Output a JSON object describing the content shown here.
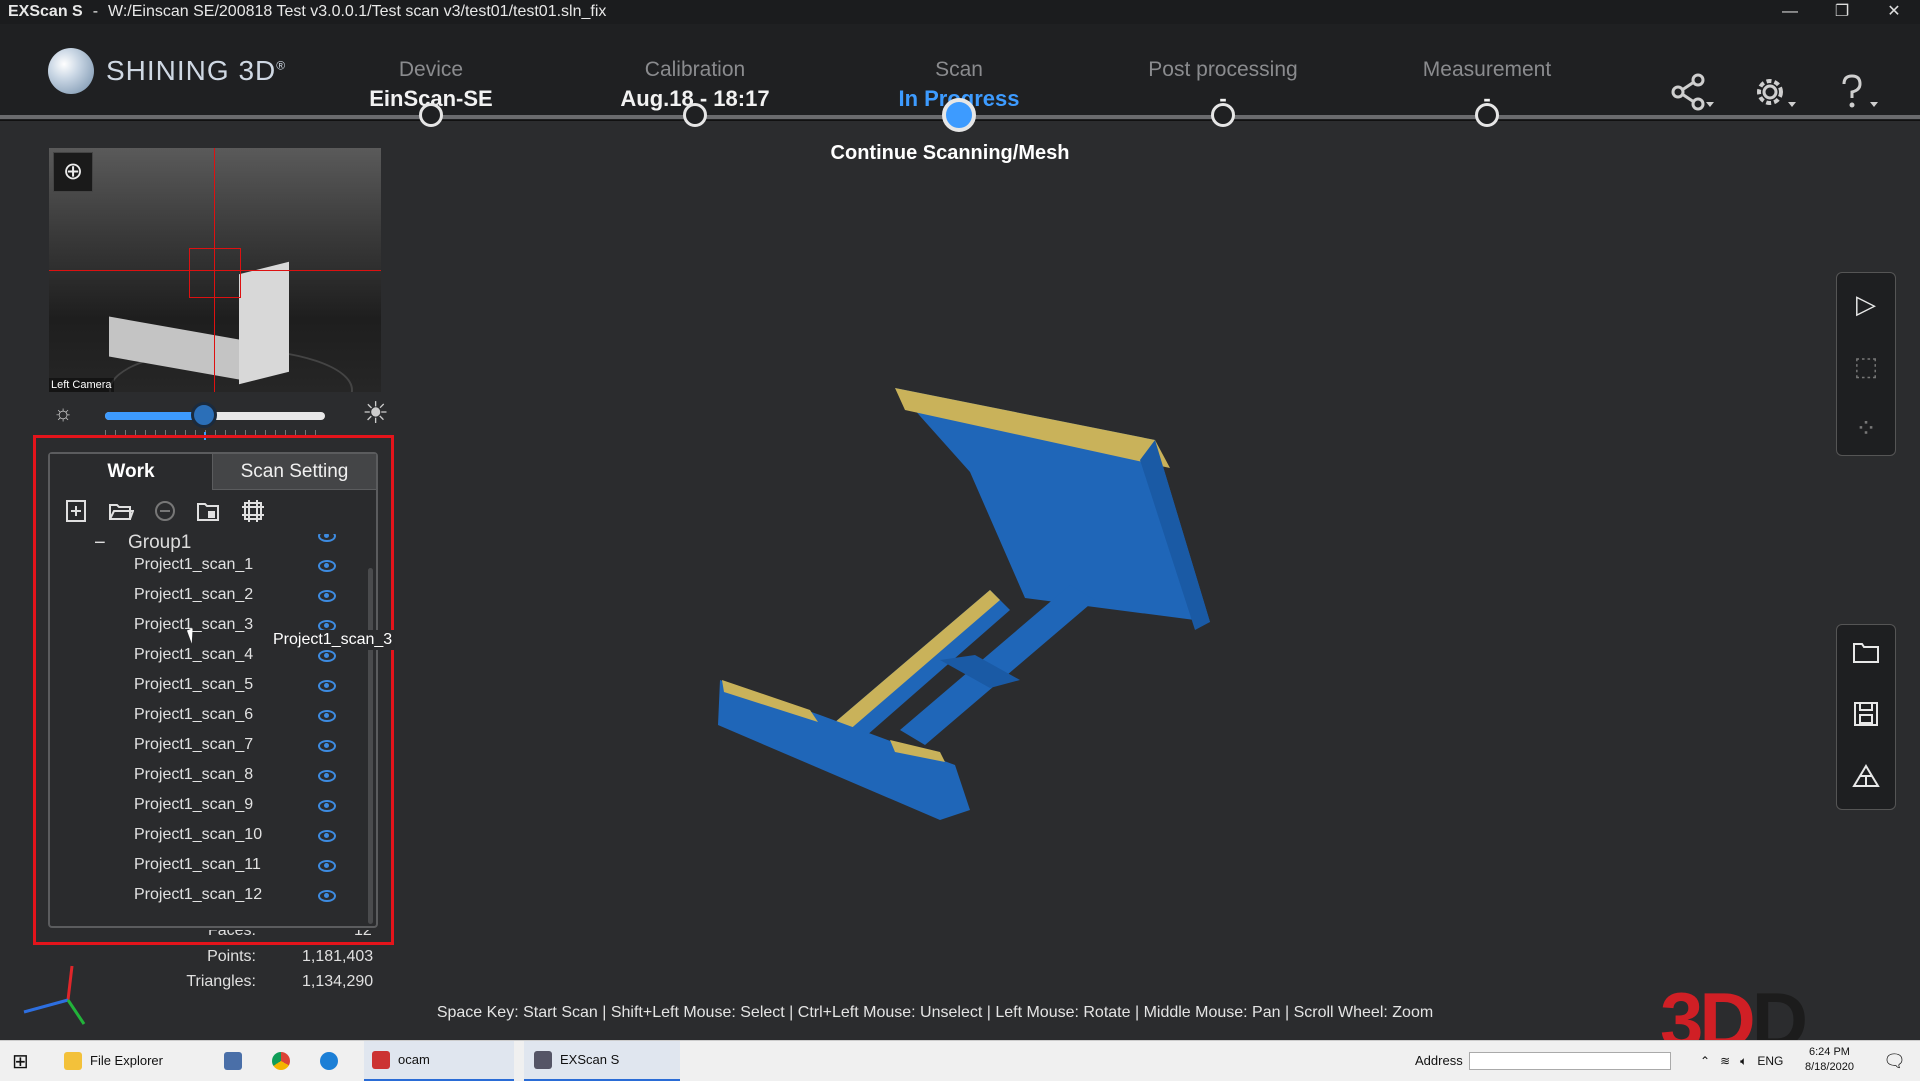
{
  "window": {
    "app_name": "EXScan S",
    "separator": "-",
    "path": "W:/Einscan SE/200818 Test v3.0.0.1/Test scan v3/test01/test01.sln_fix",
    "controls": [
      "—",
      "❐",
      "✕"
    ]
  },
  "brand": {
    "name": "SHINING 3D",
    "mark": "®"
  },
  "steps": [
    {
      "title": "Device",
      "value": "EinScan-SE",
      "active": false
    },
    {
      "title": "Calibration",
      "value": "Aug.18 - 18:17",
      "active": false
    },
    {
      "title": "Scan",
      "value": "In Progress",
      "active": true
    },
    {
      "title": "Post processing",
      "value": "-",
      "active": false
    },
    {
      "title": "Measurement",
      "value": "-",
      "active": false
    }
  ],
  "header_icons": [
    "share-icon",
    "gear-icon",
    "help-icon"
  ],
  "continue_label": "Continue Scanning/Mesh",
  "camera": {
    "label": "Left Camera"
  },
  "brightness": {
    "value_fraction": 0.45
  },
  "panel": {
    "tabs": {
      "work": "Work",
      "scan_setting": "Scan Setting"
    },
    "group_label": "Group1",
    "group_toggle": "−",
    "scans": [
      "Project1_scan_1",
      "Project1_scan_2",
      "Project1_scan_3",
      "Project1_scan_4",
      "Project1_scan_5",
      "Project1_scan_6",
      "Project1_scan_7",
      "Project1_scan_8",
      "Project1_scan_9",
      "Project1_scan_10",
      "Project1_scan_11",
      "Project1_scan_12"
    ],
    "tooltip": "Project1_scan_3"
  },
  "stats": {
    "faces_label": "Faces:",
    "faces_value": "12",
    "points_label": "Points:",
    "points_value": "1,181,403",
    "triangles_label": "Triangles:",
    "triangles_value": "1,134,290"
  },
  "hint": "Space Key: Start Scan | Shift+Left Mouse: Select | Ctrl+Left Mouse: Unselect | Left Mouse: Rotate | Middle Mouse: Pan | Scroll Wheel: Zoom",
  "watermark": {
    "red": "3D",
    "dark": "D"
  },
  "colors": {
    "accent": "#3d9bff",
    "highlight_frame": "#e4141b",
    "scan_blue": "#1f66b8",
    "scan_yellow": "#c9b25a"
  },
  "taskbar": {
    "file_explorer": "File Explorer",
    "ocam": "ocam",
    "exscan": "EXScan S",
    "address_label": "Address",
    "lang": "ENG",
    "time": "6:24 PM",
    "date": "8/18/2020"
  }
}
